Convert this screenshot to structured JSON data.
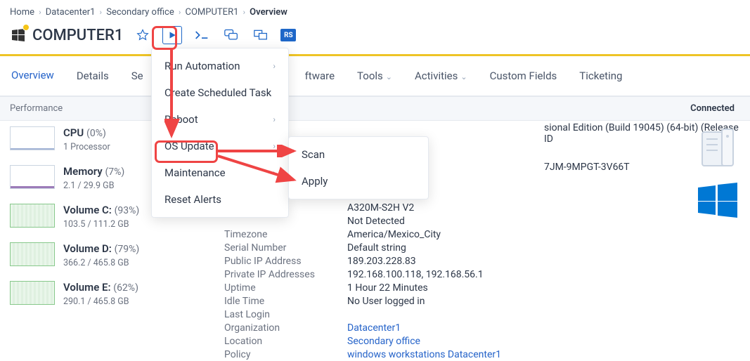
{
  "breadcrumb": {
    "items": [
      "Home",
      "Datacenter1",
      "Secondary office",
      "COMPUTER1"
    ],
    "current": "Overview"
  },
  "title": "COMPUTER1",
  "tabs": {
    "overview": "Overview",
    "details": "Details",
    "se_fragment": "Se",
    "software_fragment": "ftware",
    "tools": "Tools",
    "activities": "Activities",
    "custom_fields": "Custom Fields",
    "ticketing": "Ticketing"
  },
  "panel": {
    "performance_label": "Performance",
    "connected_label": "Connected"
  },
  "metrics": {
    "cpu": {
      "name": "CPU",
      "pct": "(0%)",
      "sub": "1 Processor"
    },
    "mem": {
      "name": "Memory",
      "pct": "(7%)",
      "sub": "2.1 / 29.9 GB"
    },
    "volc": {
      "name": "Volume C:",
      "pct": "(93%)",
      "sub": "103.5 / 111.2 GB"
    },
    "vold": {
      "name": "Volume D:",
      "pct": "(79%)",
      "sub": "366.2 / 465.8 GB"
    },
    "vole": {
      "name": "Volume E:",
      "pct": "(62%)",
      "sub": "290.1 / 465.8 GB"
    }
  },
  "details": {
    "os_fragment": "sional Edition (Build 19045) (64-bit) (Release ID",
    "key_fragment": "7JM-9MPGT-3V66T",
    "system_manufacturer": {
      "label": "",
      "value": ""
    },
    "motherboard": {
      "label": "",
      "value": "A320M-S2H V2"
    },
    "tpm": {
      "label": "",
      "value": "Not Detected"
    },
    "timezone": {
      "label": "Timezone",
      "value": "America/Mexico_City"
    },
    "serial": {
      "label": "Serial Number",
      "value": "Default string"
    },
    "public_ip": {
      "label": "Public IP Address",
      "value": "189.203.228.83"
    },
    "private_ip": {
      "label": "Private IP Addresses",
      "value": "192.168.100.118, 192.168.56.1"
    },
    "uptime": {
      "label": "Uptime",
      "value": "1 Hour 22 Minutes"
    },
    "idle": {
      "label": "Idle Time",
      "value": "No User logged in"
    },
    "lastlogin": {
      "label": "Last Login",
      "value": ""
    },
    "org": {
      "label": "Organization",
      "value": "Datacenter1"
    },
    "location": {
      "label": "Location",
      "value": "Secondary office"
    },
    "policy": {
      "label": "Policy",
      "value": "windows workstations Datacenter1"
    }
  },
  "menu1": {
    "run_automation": "Run Automation",
    "create_scheduled_task": "Create Scheduled Task",
    "reboot": "Reboot",
    "os_update": "OS Update",
    "maintenance": "Maintenance",
    "reset_alerts": "Reset Alerts"
  },
  "menu2": {
    "scan": "Scan",
    "apply": "Apply"
  },
  "icons": {
    "star": "star-icon",
    "play": "play-icon",
    "terminal": "terminal-icon",
    "chat": "chat-icon",
    "screens": "screens-icon",
    "rs": "rs-icon"
  }
}
